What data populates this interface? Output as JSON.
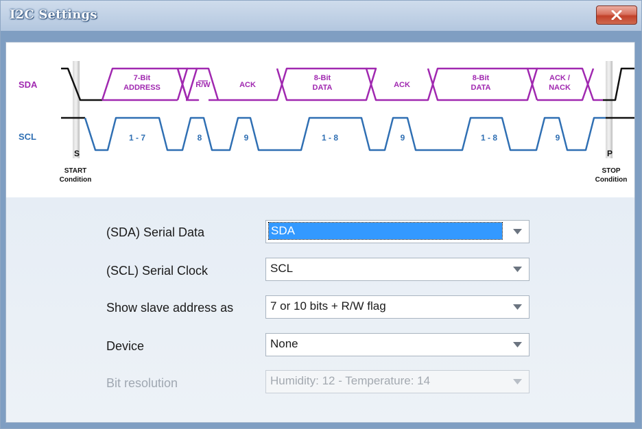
{
  "window": {
    "title": "I2C Settings"
  },
  "diagram": {
    "signals": {
      "sda": "SDA",
      "scl": "SCL"
    },
    "start": {
      "letter": "S",
      "line1": "START",
      "line2": "Condition"
    },
    "stop": {
      "letter": "P",
      "line1": "STOP",
      "line2": "Condition"
    },
    "sda_labels": [
      {
        "line1": "7-Bit",
        "line2": "ADDRESS"
      },
      {
        "line1": "R/W",
        "line2": ""
      },
      {
        "line1": "ACK",
        "line2": ""
      },
      {
        "line1": "8-Bit",
        "line2": "DATA"
      },
      {
        "line1": "ACK",
        "line2": ""
      },
      {
        "line1": "8-Bit",
        "line2": "DATA"
      },
      {
        "line1": "ACK /",
        "line2": "NACK"
      }
    ],
    "scl_labels": [
      "1 - 7",
      "8",
      "9",
      "1 - 8",
      "9",
      "1 - 8",
      "9"
    ],
    "colors": {
      "sda": "#a028b0",
      "scl": "#2f6fb3",
      "idle": "#111111"
    }
  },
  "form": {
    "rows": [
      {
        "label": "(SDA) Serial Data",
        "value": "SDA",
        "enabled": true,
        "selected": true
      },
      {
        "label": "(SCL) Serial Clock",
        "value": "SCL",
        "enabled": true,
        "selected": false
      },
      {
        "label": "Show slave address as",
        "value": "7 or 10 bits + R/W flag",
        "enabled": true,
        "selected": false
      },
      {
        "label": "Device",
        "value": "None",
        "enabled": true,
        "selected": false
      },
      {
        "label": "Bit resolution",
        "value": "Humidity: 12 - Temperature: 14",
        "enabled": false,
        "selected": false
      }
    ]
  }
}
